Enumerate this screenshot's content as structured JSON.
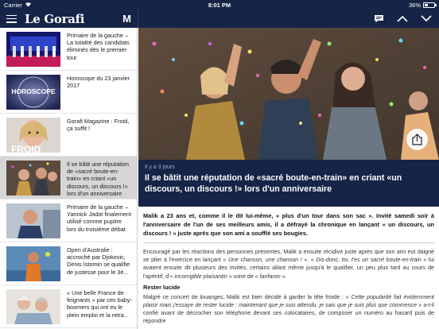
{
  "status_bar": {
    "carrier": "Carrier",
    "time": "8:01 PM",
    "battery": "36%",
    "battery_level": 0.36
  },
  "navbar": {
    "logo": "Le Gorafi",
    "m_label": "M"
  },
  "sidebar": {
    "items": [
      {
        "title": "Primaire de la gauche – La totalité des candidats éliminés dès le premier tour"
      },
      {
        "title": "Horoscope du 23 janvier 2017",
        "thumb_text": "HOROSCOPE"
      },
      {
        "title": "Gorafi Magazine : Froid, ça suffit !",
        "thumb_text": "FROID"
      },
      {
        "title": "Il se bâtit une réputation de «sacré boute-en-train» en criant «un discours, un discours !» lors d'un anniversaire"
      },
      {
        "title": "Primaire de la gauche – Yannick Jadot finalement utilisé comme pupitre lors du troisième débat"
      },
      {
        "title": "Open d'Australie : accroché par Djokovic, Denis Istomin se qualifie de justesse pour le 3è..."
      },
      {
        "title": "« Une belle France de feignants » par ces baby-boomers qui ont eu le plein emploi et la retra..."
      }
    ]
  },
  "article": {
    "date": "Il y a 3 jours",
    "title": "Il se bâtit une réputation de «sacré boute-en-train» en criant «un discours, un discours !» lors d'un anniversaire",
    "lede": "Malik a 23 ans et, comme il le dit lui-même, « plus d'un tour dans son sac ». Invité samedi soir à l'anniversaire de l'un de ses meilleurs amis, il a défrayé la chronique en lançant « un discours, un discours ! » juste après que son ami a soufflé ses bougies.",
    "p1_a": "Encouragé par les réactions des personnes présentes, Malik a ensuite récidivé juste après que son ami eut daigné se plier à l'exercice en lançant « ",
    "p1_i1": "Une chanson, une chanson !",
    "p1_b": " ». « ",
    "p1_i2": "Dis-donc, toi, t'es un sacré boute-en-train",
    "p1_c": " » lui avaient ensuite dit plusieurs des invités, certains allant même jusqu'à le qualifier, un peu plus tard au cours de l'apéritif, d'« ",
    "p1_i3": "incorrigible plaisantin",
    "p1_d": " » voire de « ",
    "p1_i4": "fanfaron",
    "p1_e": " ».",
    "subhead": "Rester lucide",
    "p2_a": "Malgré ce concert de louanges, Malik est bien décidé à garder la tête froide : « ",
    "p2_i1": "Cette popularité fait évidemment plaisir mais j'essaye de rester lucide : maintenant que je suis attendu, je sais que je suis plus que commence",
    "p2_b": " » a-t-il confié avant de décrocher son téléphone devant ses colocataires, de composer un numéro au hasard puis de répondre"
  }
}
